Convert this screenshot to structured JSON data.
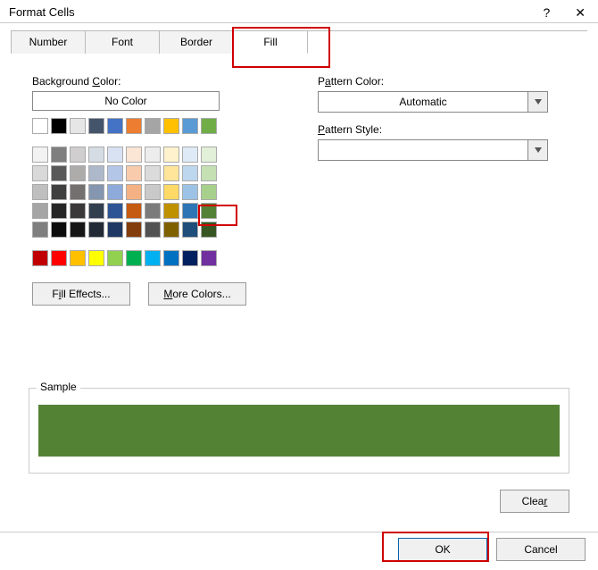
{
  "window": {
    "title": "Format Cells",
    "help": "?",
    "close": "✕"
  },
  "tabs": [
    "Number",
    "Font",
    "Border",
    "Fill"
  ],
  "active_tab_index": 3,
  "left": {
    "bg_label": "Background Color:",
    "nocolor": "No Color",
    "fill_effects": "Fill Effects...",
    "more_colors": "More Colors...",
    "row1": [
      "#ffffff",
      "#000000",
      "#e7e6e6",
      "#44546a",
      "#4472c4",
      "#ed7d31",
      "#a5a5a5",
      "#ffc000",
      "#5b9bd5",
      "#70ad47"
    ],
    "row2": [
      "#f2f2f2",
      "#7f7f7f",
      "#d0cece",
      "#d6dce4",
      "#d9e2f3",
      "#fbe5d5",
      "#ededed",
      "#fff2cc",
      "#deebf6",
      "#e2efd9"
    ],
    "row3": [
      "#d9d9d9",
      "#595959",
      "#aeabab",
      "#adb9ca",
      "#b4c6e7",
      "#f7cbac",
      "#dbdbdb",
      "#fee599",
      "#bdd7ee",
      "#c5e0b3"
    ],
    "row4": [
      "#bfbfbf",
      "#3f3f3f",
      "#757070",
      "#8496b0",
      "#8eaadb",
      "#f4b183",
      "#c9c9c9",
      "#ffd965",
      "#9cc3e5",
      "#a8d08d"
    ],
    "row5": [
      "#a5a5a5",
      "#262626",
      "#3a3838",
      "#323f4f",
      "#2f5496",
      "#c55a11",
      "#7b7b7b",
      "#bf9000",
      "#2e75b5",
      "#538135"
    ],
    "row6": [
      "#7f7f7f",
      "#0c0c0c",
      "#171616",
      "#222a35",
      "#1f3864",
      "#833c0b",
      "#525252",
      "#7f6000",
      "#1e4e79",
      "#375623"
    ],
    "std": [
      "#c00000",
      "#ff0000",
      "#ffc000",
      "#ffff00",
      "#92d050",
      "#00b050",
      "#00b0f0",
      "#0070c0",
      "#002060",
      "#7030a0"
    ],
    "selected_color": "#538135"
  },
  "right": {
    "pattern_color_label": "Pattern Color:",
    "pattern_color_value": "Automatic",
    "pattern_style_label": "Pattern Style:",
    "pattern_style_value": ""
  },
  "sample": {
    "label": "Sample",
    "color": "#548235"
  },
  "buttons": {
    "clear": "Clear",
    "ok": "OK",
    "cancel": "Cancel"
  },
  "highlights": {
    "fill_tab": true,
    "selected_swatch": true,
    "ok_button": true
  }
}
